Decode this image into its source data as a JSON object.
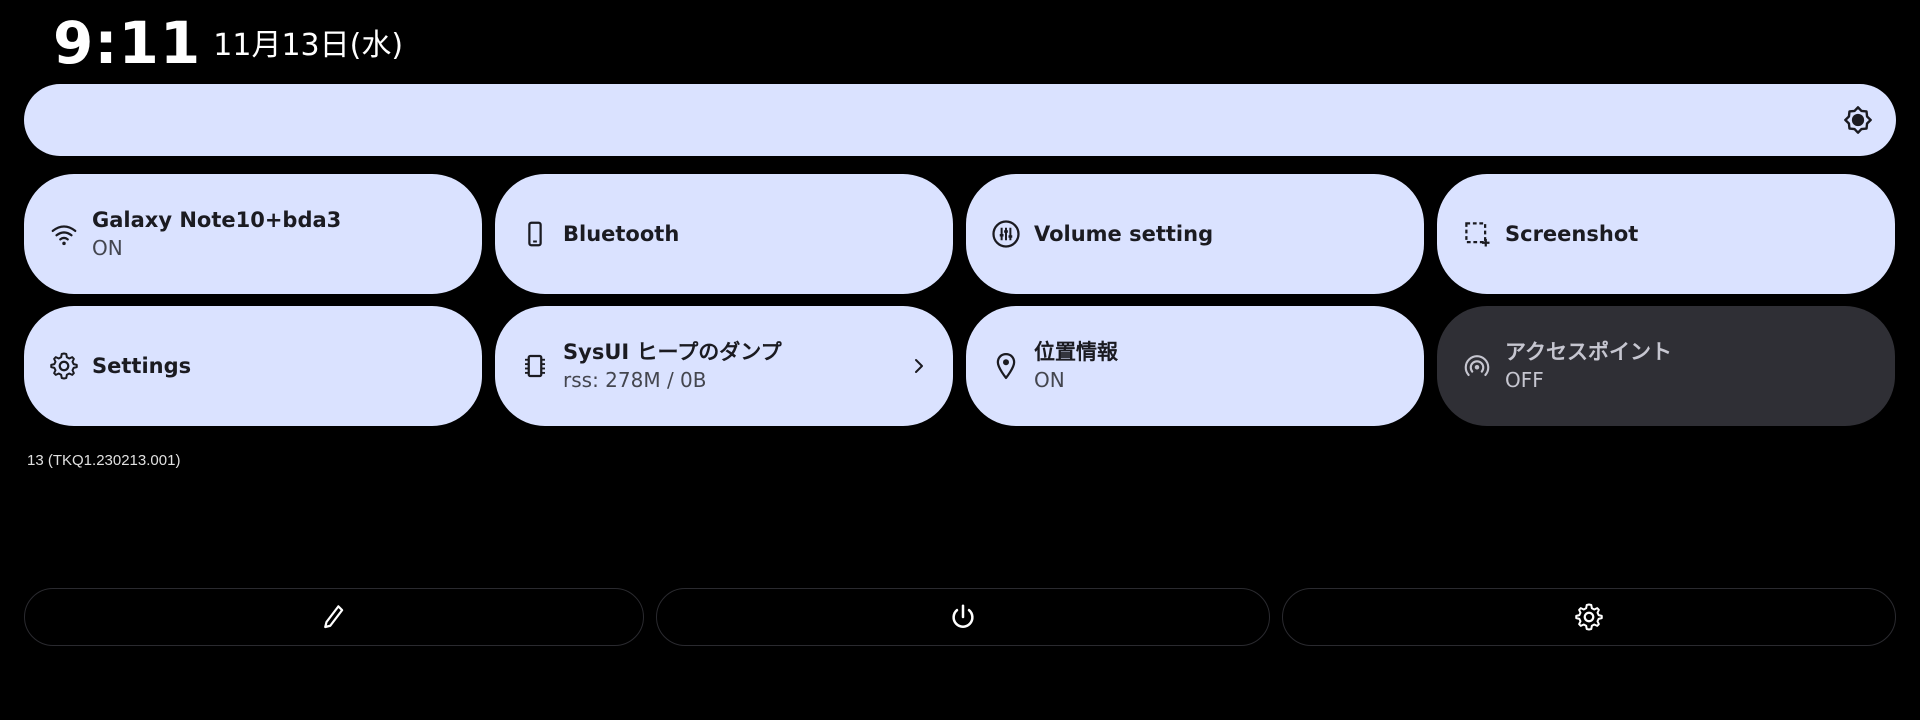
{
  "header": {
    "time": "9:11",
    "date": "11月13日(水)"
  },
  "brightness": {
    "icon": "brightness-icon"
  },
  "tiles": [
    {
      "label": "Galaxy Note10+bda3",
      "sub": "ON",
      "icon": "wifi-icon",
      "state": "on"
    },
    {
      "label": "Bluetooth",
      "sub": "",
      "icon": "phone-icon",
      "state": "on"
    },
    {
      "label": "Volume setting",
      "sub": "",
      "icon": "volume-sliders-icon",
      "state": "on"
    },
    {
      "label": "Screenshot",
      "sub": "",
      "icon": "screenshot-icon",
      "state": "on"
    },
    {
      "label": "Settings",
      "sub": "",
      "icon": "gear-icon",
      "state": "on"
    },
    {
      "label": "SysUI ヒープのダンプ",
      "sub": "rss: 278M / 0B",
      "icon": "chip-icon",
      "state": "on"
    },
    {
      "label": "位置情報",
      "sub": "ON",
      "icon": "location-pin-icon",
      "state": "on"
    },
    {
      "label": "アクセスポイント",
      "sub": "OFF",
      "icon": "hotspot-icon",
      "state": "off"
    }
  ],
  "build": "13 (TKQ1.230213.001)",
  "footer": {
    "edit_icon": "pencil-icon",
    "power_icon": "power-icon",
    "settings_icon": "gear-icon"
  },
  "colors": {
    "tile_on": "#dae2ff",
    "tile_off": "#2f2f35",
    "background": "#000000",
    "tile_text": "#1b1b21"
  }
}
